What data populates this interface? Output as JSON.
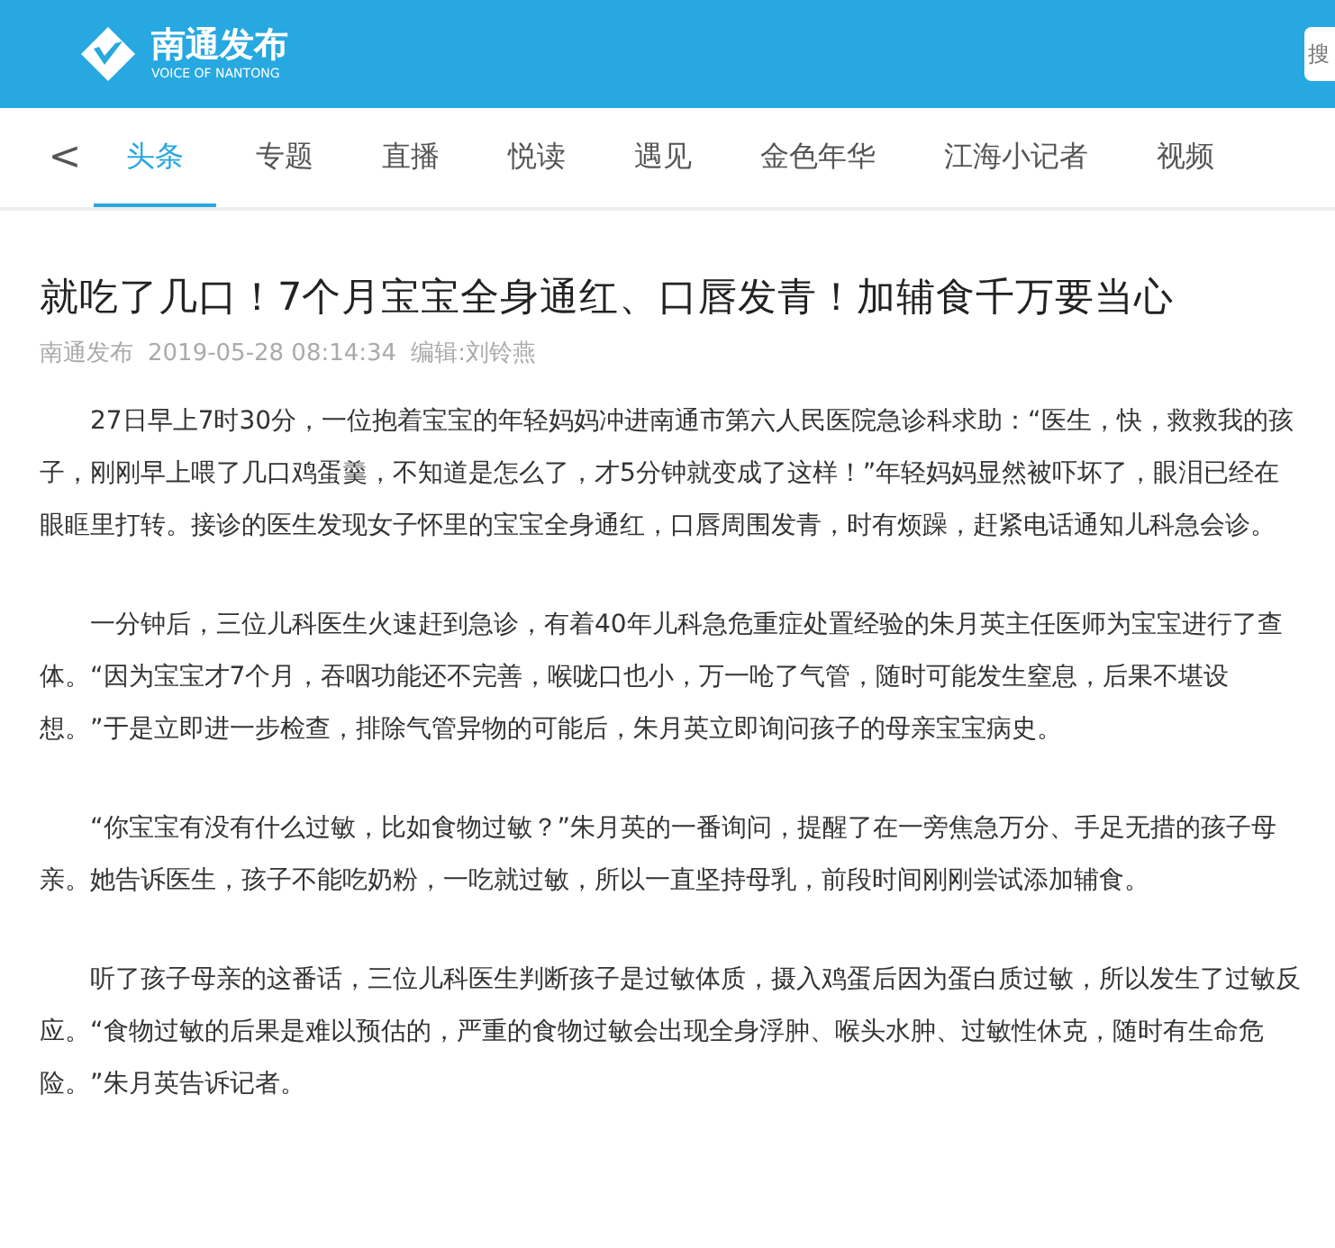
{
  "header": {
    "logo_title": "南通发布",
    "logo_subtitle": "VOICE OF NANTONG",
    "search": {
      "placeholder": "搜"
    }
  },
  "nav": {
    "back": "<",
    "tabs": [
      {
        "label": "头条",
        "selected": true
      },
      {
        "label": "专题",
        "selected": false
      },
      {
        "label": "直播",
        "selected": false
      },
      {
        "label": "悦读",
        "selected": false
      },
      {
        "label": "遇见",
        "selected": false
      },
      {
        "label": "金色年华",
        "selected": false
      },
      {
        "label": "江海小记者",
        "selected": false
      },
      {
        "label": "视频",
        "selected": false
      }
    ]
  },
  "article": {
    "title": "就吃了几口！7个月宝宝全身通红、口唇发青！加辅食千万要当心",
    "source": "南通发布",
    "time": "2019-05-28 08:14:34",
    "editor": "编辑:刘铃燕",
    "paragraphs": [
      "27日早上7时30分，一位抱着宝宝的年轻妈妈冲进南通市第六人民医院急诊科求助：“医生，快，救救我的孩子，刚刚早上喂了几口鸡蛋羹，不知道是怎么了，才5分钟就变成了这样！”年轻妈妈显然被吓坏了，眼泪已经在眼眶里打转。接诊的医生发现女子怀里的宝宝全身通红，口唇周围发青，时有烦躁，赶紧电话通知儿科急会诊。",
      "一分钟后，三位儿科医生火速赶到急诊，有着40年儿科急危重症处置经验的朱月英主任医师为宝宝进行了查体。“因为宝宝才7个月，吞咽功能还不完善，喉咙口也小，万一呛了气管，随时可能发生窒息，后果不堪设想。”于是立即进一步检查，排除气管异物的可能后，朱月英立即询问孩子的母亲宝宝病史。",
      "“你宝宝有没有什么过敏，比如食物过敏？”朱月英的一番询问，提醒了在一旁焦急万分、手足无措的孩子母亲。她告诉医生，孩子不能吃奶粉，一吃就过敏，所以一直坚持母乳，前段时间刚刚尝试添加辅食。",
      "听了孩子母亲的这番话，三位儿科医生判断孩子是过敏体质，摄入鸡蛋后因为蛋白质过敏，所以发生了过敏反应。“食物过敏的后果是难以预估的，严重的食物过敏会出现全身浮肿、喉头水肿、过敏性休克，随时有生命危险。”朱月英告诉记者。"
    ]
  }
}
